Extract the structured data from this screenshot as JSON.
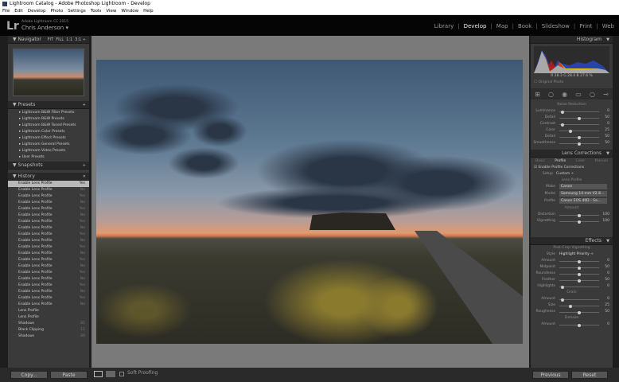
{
  "window": {
    "title": "Lightroom Catalog - Adobe Photoshop Lightroom - Develop"
  },
  "menu": [
    "File",
    "Edit",
    "Develop",
    "Photo",
    "Settings",
    "Tools",
    "View",
    "Window",
    "Help"
  ],
  "identity": {
    "logo": "Lr",
    "product": "Adobe Lightroom CC 2015",
    "user": "Chris Anderson ▾"
  },
  "modules": [
    "Library",
    "Develop",
    "Map",
    "Book",
    "Slideshow",
    "Print",
    "Web"
  ],
  "navigator": {
    "title": "Navigator",
    "zoom": [
      "FIT",
      "FILL",
      "1:1",
      "3:1 ÷"
    ]
  },
  "presets": {
    "title": "Presets",
    "items": [
      "Lightroom B&W Filter Presets",
      "Lightroom B&W Presets",
      "Lightroom B&W Toned Presets",
      "Lightroom Color Presets",
      "Lightroom Effect Presets",
      "Lightroom General Presets",
      "Lightroom Video Presets",
      "User Presets"
    ]
  },
  "snapshots": {
    "title": "Snapshots"
  },
  "history": {
    "title": "History",
    "items": [
      {
        "label": "Enable Lens Profile",
        "value": "Yes"
      },
      {
        "label": "Enable Lens Profile",
        "value": "No"
      },
      {
        "label": "Enable Lens Profile",
        "value": "Yes"
      },
      {
        "label": "Enable Lens Profile",
        "value": "No"
      },
      {
        "label": "Enable Lens Profile",
        "value": "Yes"
      },
      {
        "label": "Enable Lens Profile",
        "value": "No"
      },
      {
        "label": "Enable Lens Profile",
        "value": "Yes"
      },
      {
        "label": "Enable Lens Profile",
        "value": "No"
      },
      {
        "label": "Enable Lens Profile",
        "value": "Yes"
      },
      {
        "label": "Enable Lens Profile",
        "value": "No"
      },
      {
        "label": "Enable Lens Profile",
        "value": "Yes"
      },
      {
        "label": "Enable Lens Profile",
        "value": "No"
      },
      {
        "label": "Enable Lens Profile",
        "value": "Yes"
      },
      {
        "label": "Enable Lens Profile",
        "value": "No"
      },
      {
        "label": "Enable Lens Profile",
        "value": "Yes"
      },
      {
        "label": "Enable Lens Profile",
        "value": "No"
      },
      {
        "label": "Enable Lens Profile",
        "value": "Yes"
      },
      {
        "label": "Enable Lens Profile",
        "value": "No"
      },
      {
        "label": "Enable Lens Profile",
        "value": "Yes"
      },
      {
        "label": "Enable Lens Profile",
        "value": "No"
      },
      {
        "label": "Lens Profile",
        "value": ""
      },
      {
        "label": "Lens Profile",
        "value": ""
      },
      {
        "label": "Shadows",
        "value": "61"
      },
      {
        "label": "Black Clipping",
        "value": "11"
      },
      {
        "label": "Shadows",
        "value": "60"
      }
    ]
  },
  "left_buttons": {
    "copy": "Copy...",
    "paste": "Paste"
  },
  "toolbar": {
    "soft_proofing": "Soft Proofing"
  },
  "histogram": {
    "title": "Histogram",
    "readout": "R 28.3  G 28.4  B 27.6 %",
    "original": "Original Photo"
  },
  "noise": {
    "title": "Noise Reduction",
    "rows": [
      {
        "label": "Luminance",
        "value": "0",
        "pos": 0.05
      },
      {
        "label": "Detail",
        "value": "50",
        "pos": 0.5
      },
      {
        "label": "Contrast",
        "value": "0",
        "pos": 0.05
      },
      {
        "label": "Color",
        "value": "25",
        "pos": 0.25
      },
      {
        "label": "Detail",
        "value": "50",
        "pos": 0.5
      },
      {
        "label": "Smoothness",
        "value": "50",
        "pos": 0.5
      }
    ]
  },
  "lens": {
    "title": "Lens Corrections",
    "tabs": [
      "Basic",
      "Profile",
      "Color",
      "Manual"
    ],
    "enable": "Enable Profile Corrections",
    "setup_label": "Setup",
    "setup": "Custom ÷",
    "profile_title": "Lens Profile",
    "make_label": "Make",
    "make": "Canon",
    "model_label": "Model",
    "model": "Samsung 14 mm f/2.8...",
    "profile_label": "Profile",
    "profile": "Canon EOS 40D - Sa...",
    "amount_title": "Amount",
    "rows": [
      {
        "label": "Distortion",
        "value": "100",
        "pos": 0.5
      },
      {
        "label": "Vignetting",
        "value": "100",
        "pos": 0.5
      }
    ]
  },
  "effects": {
    "title": "Effects",
    "vig_title": "Post-Crop Vignetting",
    "style_label": "Style",
    "style": "Highlight Priority ÷",
    "vig_rows": [
      {
        "label": "Amount",
        "value": "0",
        "pos": 0.5
      },
      {
        "label": "Midpoint",
        "value": "50",
        "pos": 0.5
      },
      {
        "label": "Roundness",
        "value": "0",
        "pos": 0.5
      },
      {
        "label": "Feather",
        "value": "50",
        "pos": 0.5
      },
      {
        "label": "Highlights",
        "value": "0",
        "pos": 0.05
      }
    ],
    "grain_title": "Grain",
    "grain_rows": [
      {
        "label": "Amount",
        "value": "0",
        "pos": 0.05
      },
      {
        "label": "Size",
        "value": "25",
        "pos": 0.25
      },
      {
        "label": "Roughness",
        "value": "50",
        "pos": 0.5
      }
    ],
    "dehaze_title": "Dehaze",
    "dehaze_rows": [
      {
        "label": "Amount",
        "value": "0",
        "pos": 0.5
      }
    ]
  },
  "right_buttons": {
    "previous": "Previous",
    "reset": "Reset"
  }
}
